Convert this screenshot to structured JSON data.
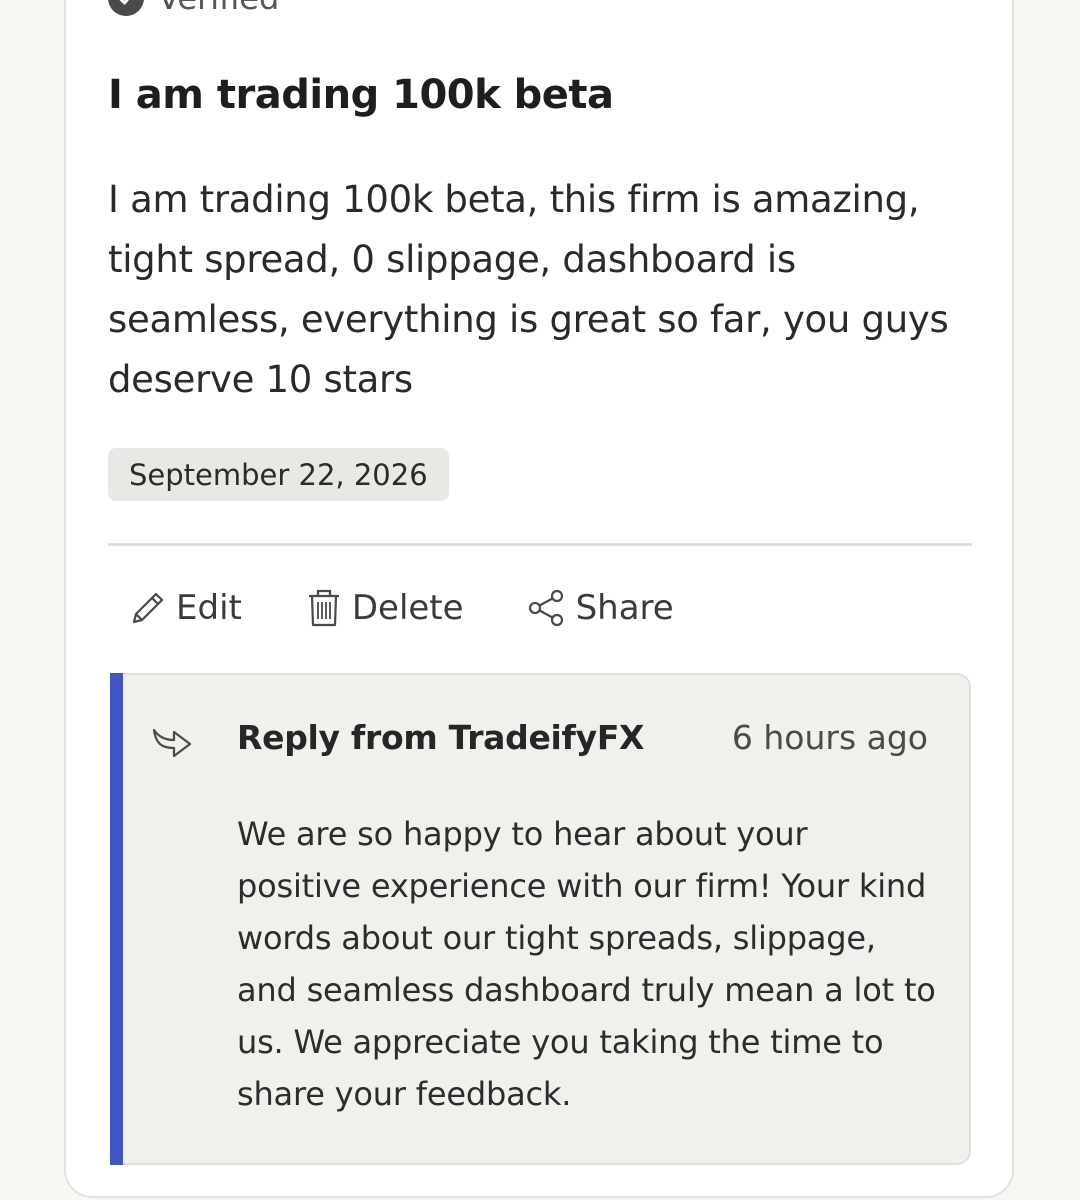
{
  "review": {
    "verified_label": "Verified",
    "title": "I am trading 100k beta",
    "body": "I am trading 100k beta, this firm is amazing, tight spread, 0 slippage, dashboard is seamless, everything is great so far, you guys deserve 10 stars",
    "date": "September 22, 2026"
  },
  "actions": {
    "edit_label": "Edit",
    "delete_label": "Delete",
    "share_label": "Share"
  },
  "reply": {
    "title": "Reply from TradeifyFX",
    "time": "6 hours ago",
    "text": "We are so happy to hear about your positive experience with our firm! Your kind words about our tight spreads, slippage, and seamless dashboard truly mean a lot to us. We appreciate you taking the time to share your feedback."
  },
  "icons": {
    "verified": "check-circle-icon",
    "edit": "pencil-icon",
    "delete": "trash-icon",
    "share": "share-icon",
    "reply": "reply-arrow-icon"
  },
  "colors": {
    "accent": "#3f55c6",
    "reply_background": "#f2f0ed",
    "chip_background": "#e9e8e5"
  }
}
